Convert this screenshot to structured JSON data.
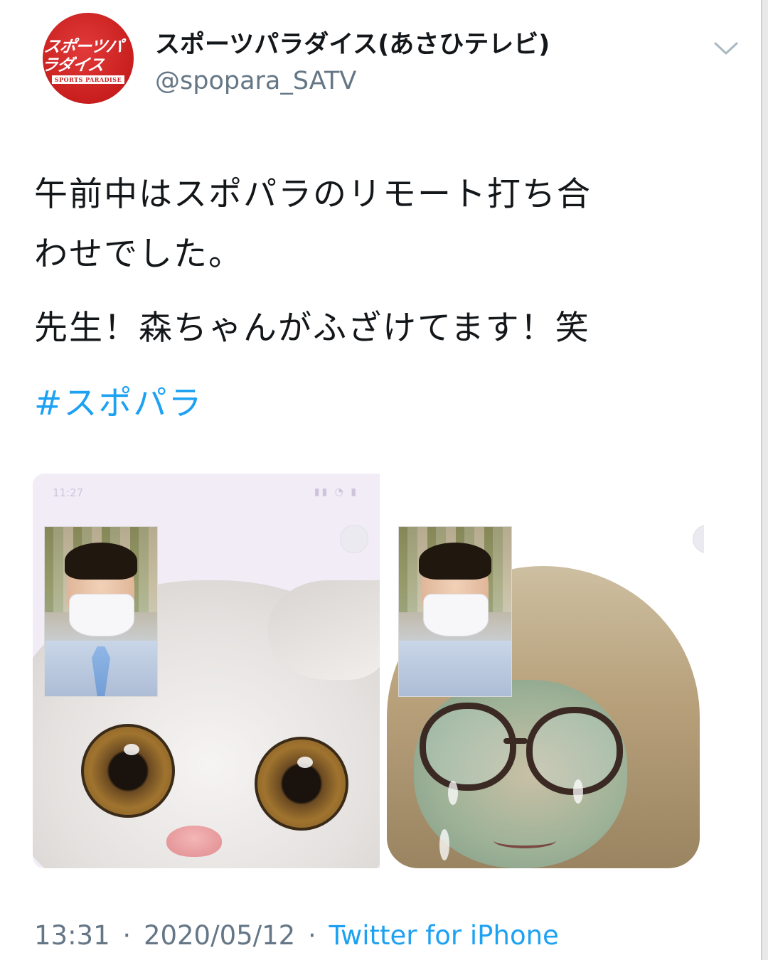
{
  "header": {
    "avatar_logo_text": "スポーツパラダイス",
    "avatar_logo_subtext": "SPORTS PARADISE",
    "display_name": "スポーツパラダイス(あさひテレビ)",
    "handle": "@spopara_SATV",
    "menu_icon": "chevron-down-icon"
  },
  "tweet": {
    "line1": "午前中はスポパラのリモート打ち合",
    "line2": "わせでした。",
    "line3": "先生！森ちゃんがふざけてます！笑",
    "hashtag": "#スポパラ"
  },
  "media": {
    "left_status_time": "11:27",
    "left_status_icons": "▮▮ ◔ ▮"
  },
  "footer": {
    "time": "13:31",
    "separator": "·",
    "date": "2020/05/12",
    "source": "Twitter for iPhone"
  },
  "colors": {
    "link": "#1da1f2",
    "secondary_text": "#657786",
    "primary_text": "#14171a",
    "avatar_red": "#c81e1e"
  }
}
